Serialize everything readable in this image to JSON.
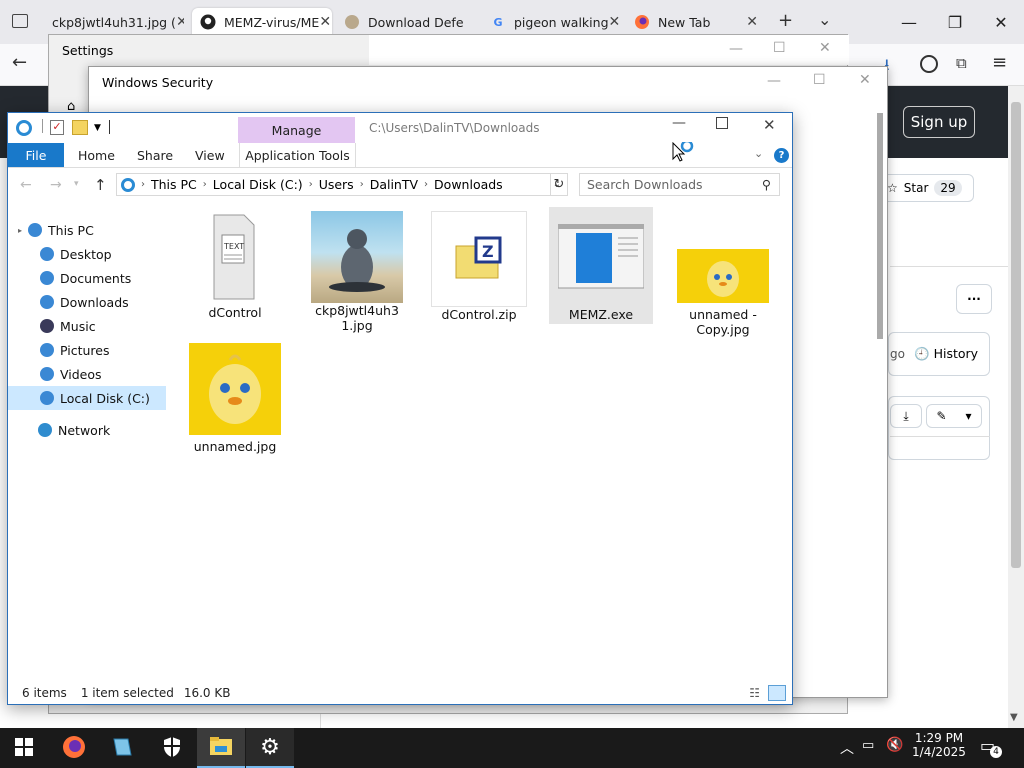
{
  "browser": {
    "tabs": [
      {
        "label": "ckp8jwtl4uh31.jpg (",
        "icon": "image-icon"
      },
      {
        "label": "MEMZ-virus/ME",
        "icon": "github-icon"
      },
      {
        "label": "Download Defe",
        "icon": "page-icon"
      },
      {
        "label": "pigeon walking",
        "icon": "google-icon"
      },
      {
        "label": "New Tab",
        "icon": "firefox-icon"
      }
    ],
    "close_glyph": "✕",
    "new_tab": "+",
    "tab_list": "⌄",
    "min": "—",
    "max": "❐",
    "close": "✕",
    "back": "←"
  },
  "github": {
    "signup": "Sign up",
    "star_label": "Star",
    "star_count": "29",
    "history_label": "History",
    "more": "···",
    "partial_text": "go"
  },
  "settings": {
    "title": "Settings"
  },
  "security": {
    "title": "Windows Security"
  },
  "explorer": {
    "manage_label": "Manage",
    "path_title": "C:\\Users\\DalinTV\\Downloads",
    "ribbon": {
      "file": "File",
      "home": "Home",
      "share": "Share",
      "view": "View",
      "app_tools": "Application Tools"
    },
    "breadcrumb": [
      "This PC",
      "Local Disk (C:)",
      "Users",
      "DalinTV",
      "Downloads"
    ],
    "search_placeholder": "Search Downloads",
    "nav": [
      {
        "label": "This PC",
        "color": "#3a88d4"
      },
      {
        "label": "Desktop",
        "color": "#3a88d4"
      },
      {
        "label": "Documents",
        "color": "#3a88d4"
      },
      {
        "label": "Downloads",
        "color": "#3a88d4"
      },
      {
        "label": "Music",
        "color": "#3a3a5a"
      },
      {
        "label": "Pictures",
        "color": "#3a88d4"
      },
      {
        "label": "Videos",
        "color": "#3a88d4"
      },
      {
        "label": "Local Disk (C:)",
        "color": "#3a88d4"
      },
      {
        "label": "Network",
        "color": "#2f8ccf"
      }
    ],
    "files": [
      {
        "name": "dControl"
      },
      {
        "name": "ckp8jwtl4uh31.jpg"
      },
      {
        "name": "dControl.zip"
      },
      {
        "name": "MEMZ.exe"
      },
      {
        "name": "unnamed - Copy.jpg"
      },
      {
        "name": "unnamed.jpg"
      }
    ],
    "status": {
      "items": "6 items",
      "selected": "1 item selected",
      "size": "16.0 KB"
    }
  },
  "taskbar": {
    "time": "1:29 PM",
    "date": "1/4/2025",
    "notification_count": "4"
  }
}
